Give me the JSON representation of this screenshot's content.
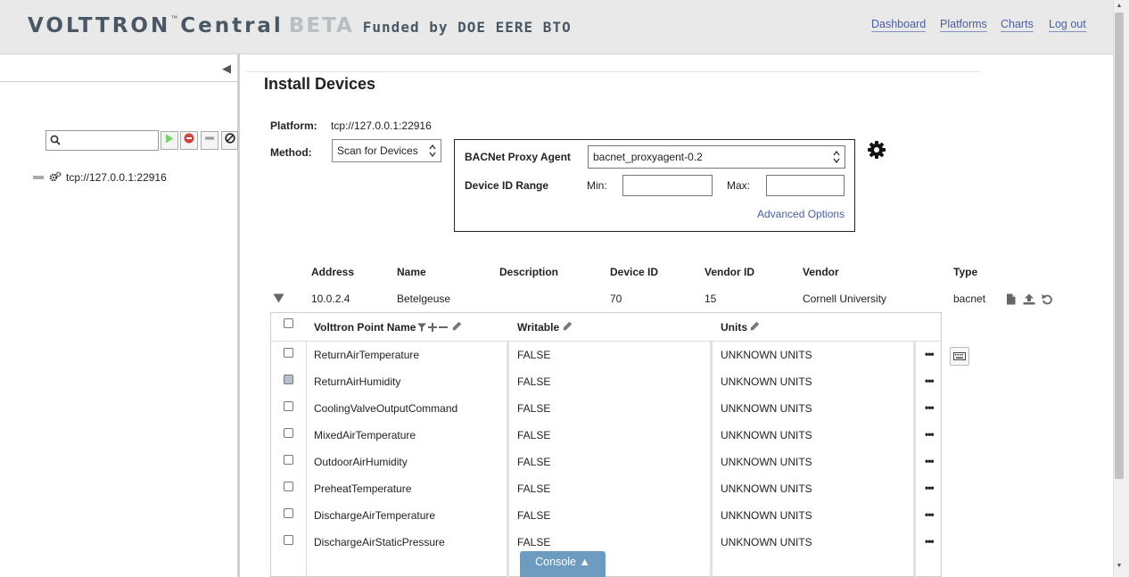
{
  "header": {
    "logo_main": "VOLTTRON",
    "logo_tm": "™",
    "logo_central": "Central",
    "logo_beta": "BETA",
    "logo_funded": "Funded by DOE EERE BTO",
    "nav": [
      "Dashboard",
      "Platforms",
      "Charts",
      "Log out"
    ]
  },
  "sidebar": {
    "toggle_glyph": "◀",
    "search_placeholder": "",
    "tree": [
      {
        "label": "tcp://127.0.0.1:22916"
      }
    ]
  },
  "page": {
    "title": "Install Devices",
    "platform_label": "Platform:",
    "platform_value": "tcp://127.0.0.1:22916",
    "method_label": "Method:",
    "method_value": "Scan for Devices",
    "proxy_label": "BACNet Proxy Agent",
    "proxy_value": "bacnet_proxyagent-0.2",
    "range_label": "Device ID Range",
    "min_label": "Min:",
    "min_value": "",
    "max_label": "Max:",
    "max_value": "",
    "advanced_options": "Advanced Options"
  },
  "devices": {
    "columns": [
      "Address",
      "Name",
      "Description",
      "Device ID",
      "Vendor ID",
      "Vendor",
      "Type"
    ],
    "rows": [
      {
        "address": "10.0.2.4",
        "name": "Betelgeuse",
        "description": "",
        "device_id": "70",
        "vendor_id": "15",
        "vendor": "Cornell University",
        "type": "bacnet"
      }
    ]
  },
  "points": {
    "columns": {
      "name": "Volttron Point Name",
      "writable": "Writable",
      "units": "Units"
    },
    "more_glyph": "•••",
    "rows": [
      {
        "name": "ReturnAirTemperature",
        "writable": "FALSE",
        "units": "UNKNOWN UNITS",
        "selected": false
      },
      {
        "name": "ReturnAirHumidity",
        "writable": "FALSE",
        "units": "UNKNOWN UNITS",
        "selected": true
      },
      {
        "name": "CoolingValveOutputCommand",
        "writable": "FALSE",
        "units": "UNKNOWN UNITS",
        "selected": false
      },
      {
        "name": "MixedAirTemperature",
        "writable": "FALSE",
        "units": "UNKNOWN UNITS",
        "selected": false
      },
      {
        "name": "OutdoorAirHumidity",
        "writable": "FALSE",
        "units": "UNKNOWN UNITS",
        "selected": false
      },
      {
        "name": "PreheatTemperature",
        "writable": "FALSE",
        "units": "UNKNOWN UNITS",
        "selected": false
      },
      {
        "name": "DischargeAirTemperature",
        "writable": "FALSE",
        "units": "UNKNOWN UNITS",
        "selected": false
      },
      {
        "name": "DischargeAirStaticPressure",
        "writable": "FALSE",
        "units": "UNKNOWN UNITS",
        "selected": false
      }
    ]
  },
  "console": {
    "label": "Console ▲"
  },
  "colors": {
    "accent": "#6d9cc0",
    "link": "#4a5fa0",
    "header_bg": "#e9e9e9",
    "logo": "#4a5865"
  }
}
